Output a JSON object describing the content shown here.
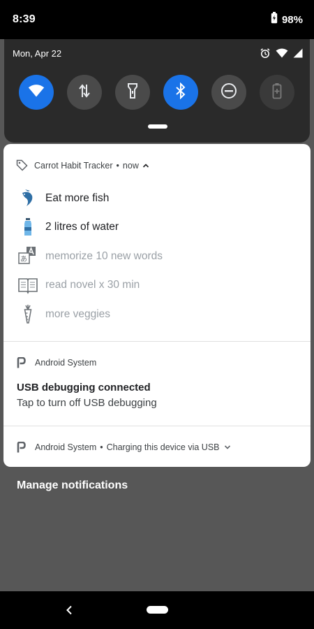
{
  "status_bar": {
    "time": "8:39",
    "battery_percent": "98%",
    "icons": [
      "battery-icon"
    ]
  },
  "quick_settings": {
    "date": "Mon, Apr 22",
    "status_icons": [
      "alarm-icon",
      "wifi-icon",
      "cellular-signal-icon"
    ],
    "tiles": [
      {
        "icon": "wifi-icon",
        "state": "on"
      },
      {
        "icon": "mobile-data-icon",
        "state": "off"
      },
      {
        "icon": "flashlight-icon",
        "state": "off"
      },
      {
        "icon": "bluetooth-icon",
        "state": "on"
      },
      {
        "icon": "do-not-disturb-icon",
        "state": "off"
      },
      {
        "icon": "battery-saver-icon",
        "state": "disabled"
      }
    ]
  },
  "habit_notification": {
    "app_name": "Carrot Habit Tracker",
    "time": "now",
    "items": [
      {
        "icon": "fish-icon",
        "label": "Eat more fish",
        "state": "done"
      },
      {
        "icon": "water-bottle-icon",
        "label": "2 litres of water",
        "state": "done"
      },
      {
        "icon": "translate-icon",
        "label": "memorize 10 new words",
        "state": "pending"
      },
      {
        "icon": "book-icon",
        "label": "read novel x 30 min",
        "state": "pending"
      },
      {
        "icon": "carrot-icon",
        "label": "more veggies",
        "state": "pending"
      }
    ]
  },
  "usb_notification": {
    "app_name": "Android System",
    "title": "USB debugging connected",
    "text": "Tap to turn off USB debugging"
  },
  "charging_notification": {
    "app_name": "Android System",
    "text": "Charging this device via USB"
  },
  "manage_notifications_label": "Manage notifications",
  "colors": {
    "accent": "#1a73e8",
    "scrim": "#575757",
    "panel": "#2a2a2a"
  }
}
